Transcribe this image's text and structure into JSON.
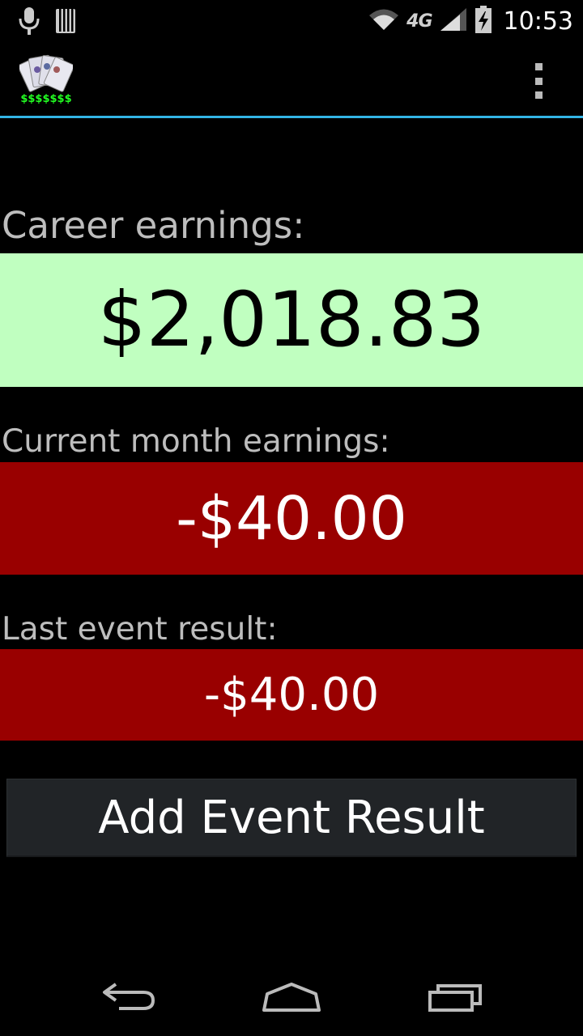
{
  "status_bar": {
    "time": "10:53",
    "network_label": "4G"
  },
  "action_bar": {
    "app_icon": "poker-cards-money-icon",
    "app_icon_text": "$$$$$$$",
    "overflow_icon": "overflow-menu-icon"
  },
  "career": {
    "label": "Career earnings:",
    "value": "$2,018.83",
    "color": "#c0ffc0"
  },
  "current_month": {
    "label": "Current month earnings:",
    "value": "-$40.00",
    "color": "#990000"
  },
  "last_event": {
    "label": "Last event result:",
    "value": "-$40.00",
    "color": "#990000"
  },
  "add_button": {
    "label": "Add Event Result"
  },
  "nav_bar": {
    "back_icon": "back-icon",
    "home_icon": "home-icon",
    "recent_icon": "recent-apps-icon"
  }
}
